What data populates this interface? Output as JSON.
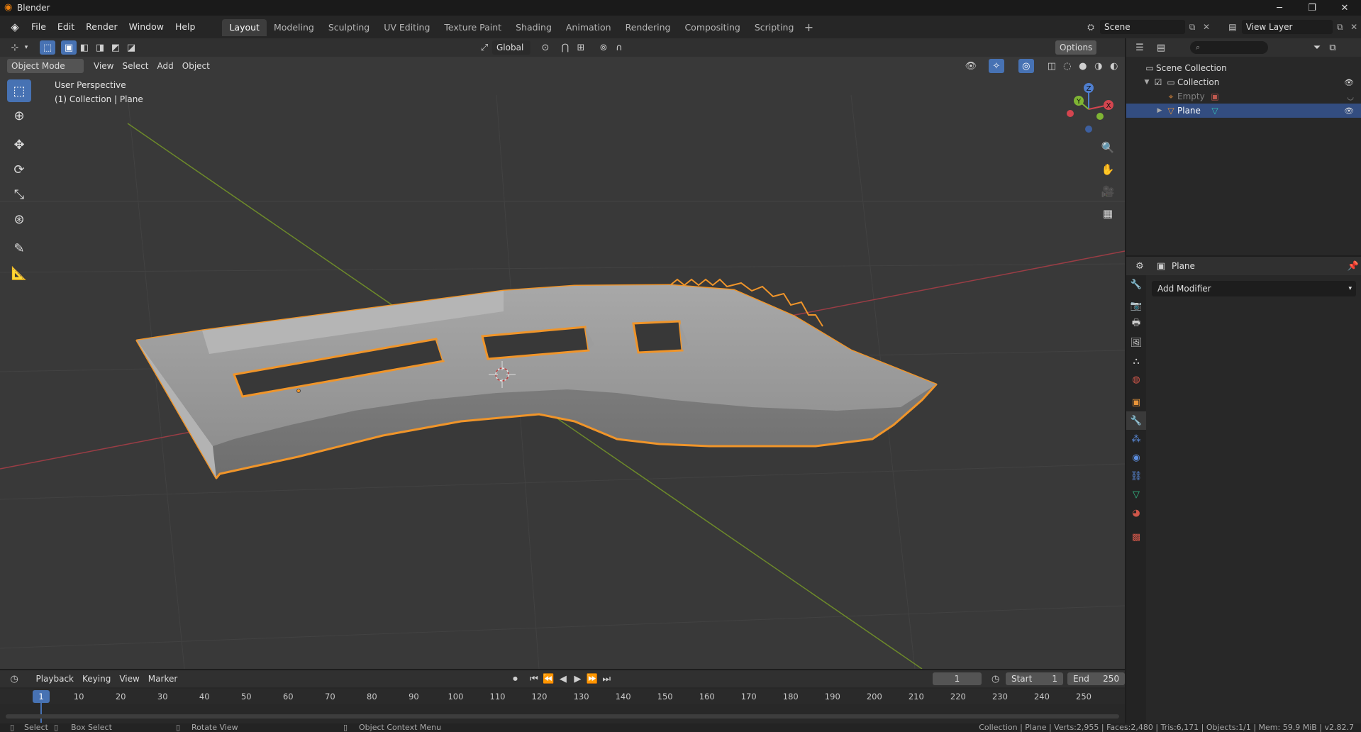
{
  "window": {
    "title": "Blender",
    "minimize": "─",
    "restore": "❐",
    "close": "✕"
  },
  "menu": [
    "File",
    "Edit",
    "Render",
    "Window",
    "Help"
  ],
  "workspaces": [
    "Layout",
    "Modeling",
    "Sculpting",
    "UV Editing",
    "Texture Paint",
    "Shading",
    "Animation",
    "Rendering",
    "Compositing",
    "Scripting"
  ],
  "workspace_add": "+",
  "scene": {
    "name": "Scene"
  },
  "view_layer": {
    "name": "View Layer"
  },
  "viewport": {
    "orientation": "Global",
    "options": "Options",
    "mode": "Object Mode",
    "menus": [
      "View",
      "Select",
      "Add",
      "Object"
    ],
    "perspective": "User Perspective",
    "context": "(1) Collection | Plane",
    "gizmo": {
      "z": "Z",
      "y": "Y",
      "x": "X"
    }
  },
  "outliner": {
    "scene_collection": "Scene Collection",
    "collection": "Collection",
    "items": [
      "Empty",
      "Plane"
    ]
  },
  "properties": {
    "object_name": "Plane",
    "add_modifier": "Add Modifier"
  },
  "timeline": {
    "menus": [
      "Playback",
      "Keying",
      "View",
      "Marker"
    ],
    "current_frame": "1",
    "start_label": "Start",
    "start": "1",
    "end_label": "End",
    "end": "250",
    "ruler": [
      "1",
      "10",
      "20",
      "30",
      "40",
      "50",
      "60",
      "70",
      "80",
      "90",
      "100",
      "110",
      "120",
      "130",
      "140",
      "150",
      "160",
      "170",
      "180",
      "190",
      "200",
      "210",
      "220",
      "230",
      "240",
      "250"
    ]
  },
  "statusbar": {
    "select": "Select",
    "box_select": "Box Select",
    "rotate_view": "Rotate View",
    "context_menu": "Object Context Menu",
    "stats": "Collection | Plane | Verts:2,955 | Faces:2,480 | Tris:6,171 | Objects:1/1 | Mem: 59.9 MiB | v2.82.7"
  }
}
